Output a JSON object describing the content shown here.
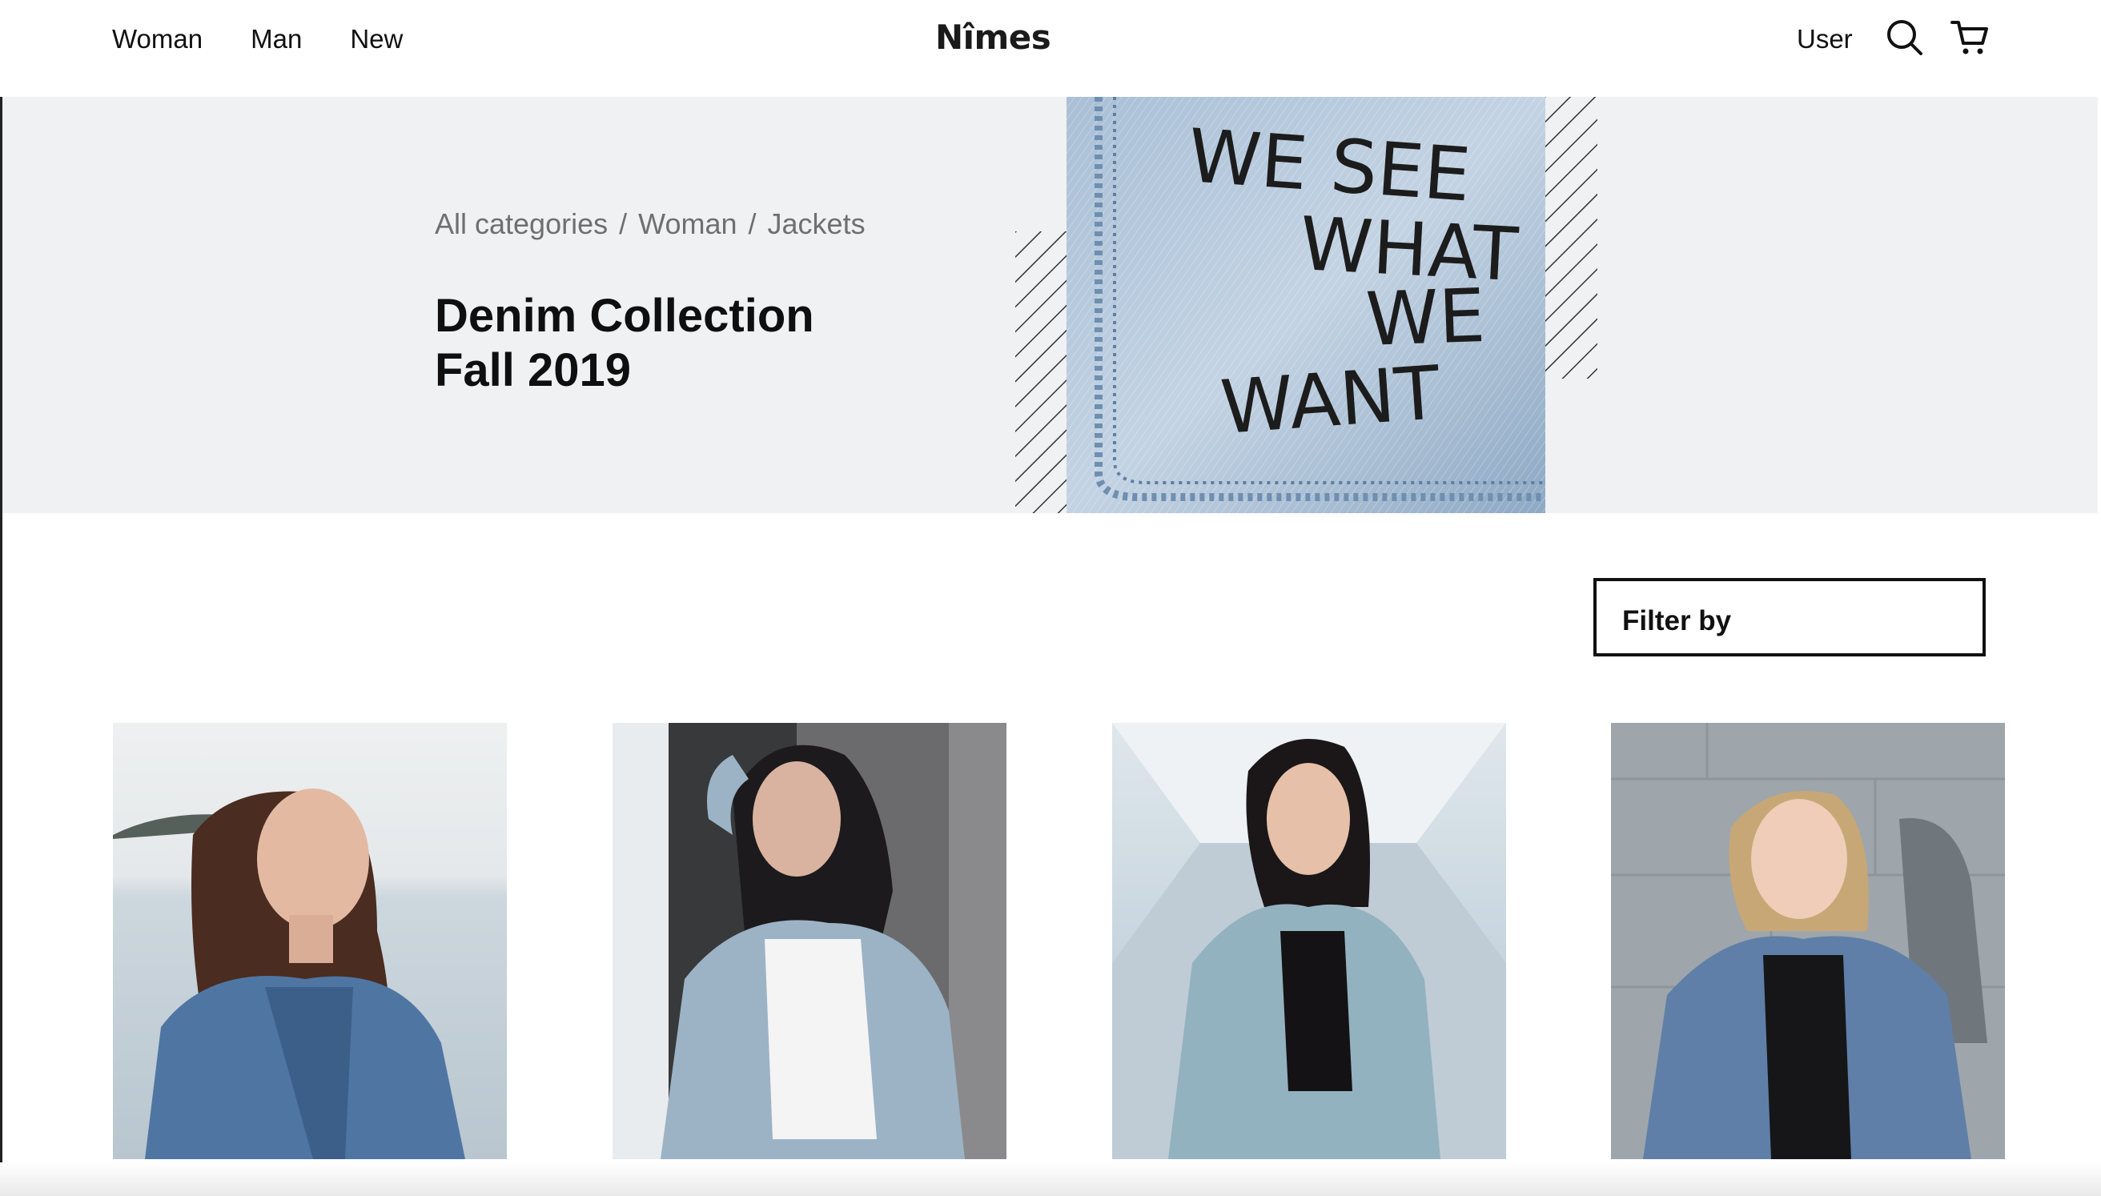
{
  "header": {
    "nav": [
      "Woman",
      "Man",
      "New"
    ],
    "logo": "Nîmes",
    "user_label": "User",
    "icons": [
      "search-icon",
      "cart-icon"
    ]
  },
  "hero": {
    "breadcrumb": [
      "All categories",
      "Woman",
      "Jackets"
    ],
    "breadcrumb_separator": "/",
    "title_line1": "Denim Collection",
    "title_line2": "Fall 2019",
    "image_text": [
      "WE SEE",
      "WHAT",
      "WE",
      "WANT"
    ],
    "bg_color": "#f0f1f2"
  },
  "filter": {
    "label": "Filter by"
  },
  "products": [
    {
      "name": "product-1",
      "scene": "woman in denim jacket by the sea"
    },
    {
      "name": "product-2",
      "scene": "woman in light denim jacket at doorway"
    },
    {
      "name": "product-3",
      "scene": "woman in denim shirt in tunnel"
    },
    {
      "name": "product-4",
      "scene": "woman in denim jacket by stone wall"
    }
  ]
}
